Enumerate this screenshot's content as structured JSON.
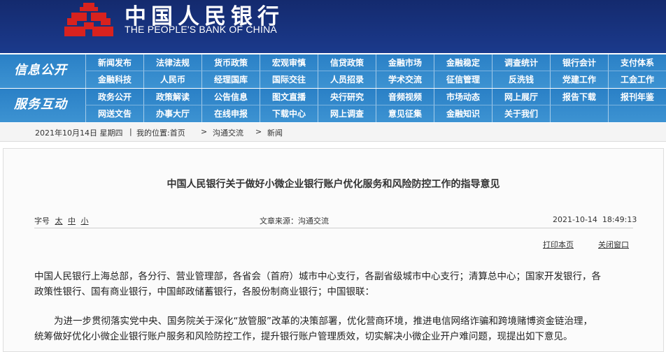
{
  "header": {
    "logo_cn": "中国人民银行",
    "logo_en": "THE PEOPLE'S BANK OF CHINA",
    "bg_color": "#17307a"
  },
  "nav1": {
    "section": "信息公开",
    "items": [
      "新闻发布",
      "法律法规",
      "货币政策",
      "宏观审慎",
      "信贷政策",
      "金融市场",
      "金融稳定",
      "调查统计",
      "银行会计",
      "支付体系",
      "金融科技",
      "人民币",
      "经理国库",
      "国际交往",
      "人员招录",
      "学术交流",
      "征信管理",
      "反洗钱",
      "党建工作",
      "工会工作"
    ]
  },
  "nav2": {
    "section": "服务互动",
    "items": [
      "政务公开",
      "政策解读",
      "公告信息",
      "图文直播",
      "央行研究",
      "音频视频",
      "市场动态",
      "网上展厅",
      "报告下载",
      "报刊年鉴",
      "网送文告",
      "办事大厅",
      "在线申报",
      "下载中心",
      "网上调查",
      "意见征集",
      "金融知识",
      "关于我们",
      "",
      ""
    ]
  },
  "breadcrumb": {
    "date": "2021年10月14日 星期四",
    "location_label": "我的位置:首页",
    "sep1": ">",
    "level2": "沟通交流",
    "sep2": ">",
    "level3": "新闻"
  },
  "article": {
    "title": "中国人民银行关于做好小微企业银行账户优化服务和风险防控工作的指导意见",
    "font_size_label": "字号",
    "font_sizes": [
      "太",
      "中",
      "小"
    ],
    "source": "文章来源：沟通交流",
    "timestamp": "2021-10-14  18:49:13",
    "print_label": "打印本页",
    "close_label": "关闭窗口",
    "para1_line1": "中国人民银行上海总部，各分行、营业管理部，各省会（首府）城市中心支行，各副省级城市中心支行；清算总中心；国家开发银行，各",
    "para1_line2": "政策性银行、国有商业银行，中国邮政储蓄银行，各股份制商业银行；中国银联：",
    "para2_line1": "为进一步贯彻落实党中央、国务院关于深化“放管服”改革的决策部署，优化营商环境，推进电信网络诈骗和跨境赌博资金链治理，",
    "para2_line2": "统筹做好优化小微企业银行账户服务和风险防控工作，提升银行账户管理质效，切实解决小微企业开户难问题，现提出如下意见。"
  }
}
